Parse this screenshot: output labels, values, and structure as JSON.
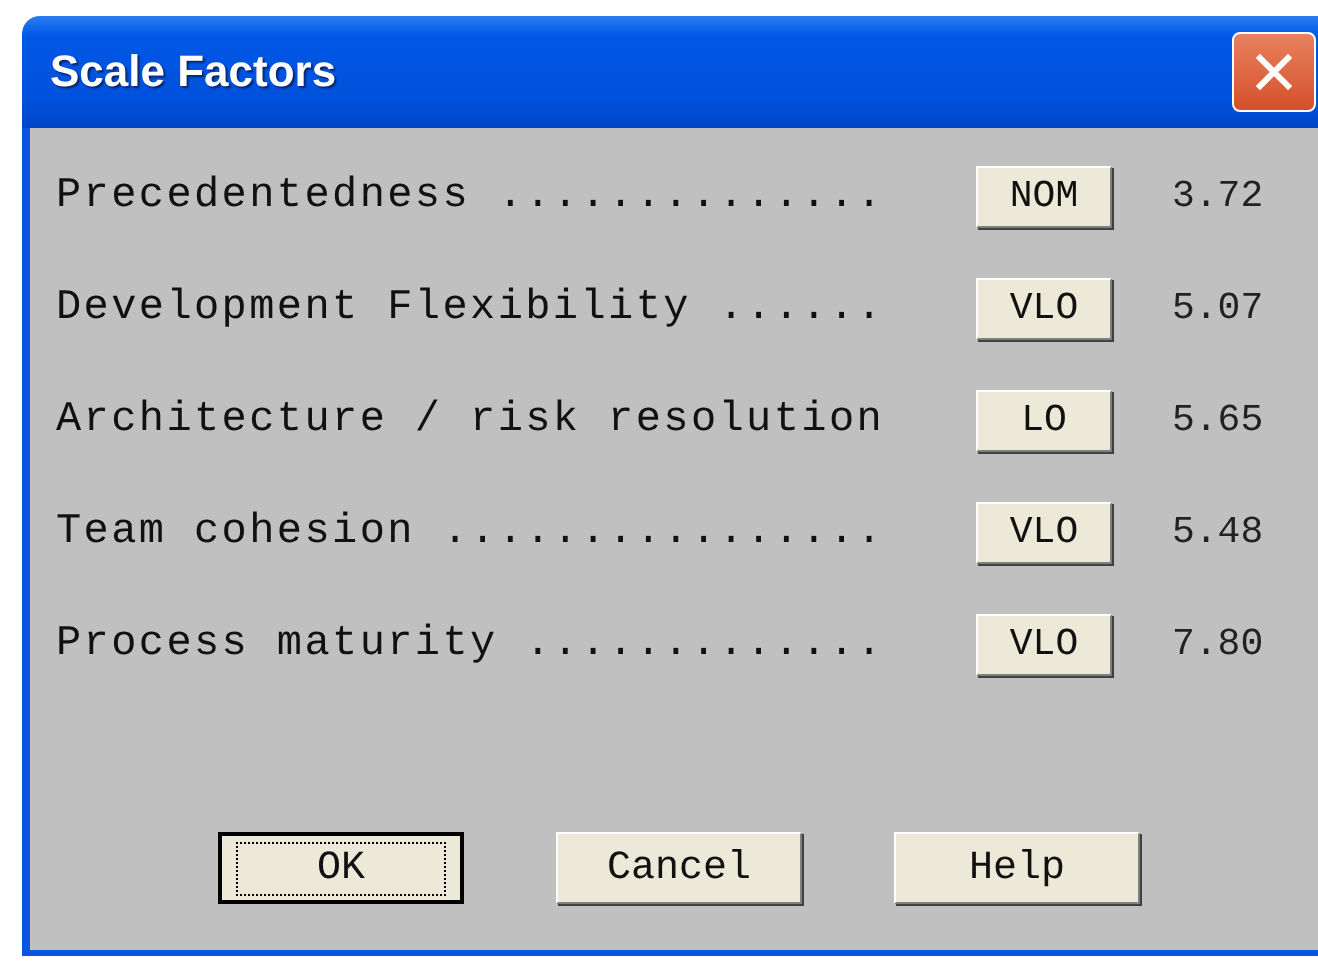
{
  "window": {
    "title": "Scale Factors"
  },
  "factors": [
    {
      "label": "Precedentedness ..............",
      "rating": "NOM",
      "value": "3.72"
    },
    {
      "label": "Development Flexibility ......",
      "rating": "VLO",
      "value": "5.07"
    },
    {
      "label": "Architecture / risk resolution",
      "rating": "LO",
      "value": "5.65"
    },
    {
      "label": "Team cohesion ................",
      "rating": "VLO",
      "value": "5.48"
    },
    {
      "label": "Process maturity .............",
      "rating": "VLO",
      "value": "7.80"
    }
  ],
  "buttons": [
    {
      "label": "OK",
      "default": true
    },
    {
      "label": "Cancel",
      "default": false
    },
    {
      "label": "Help",
      "default": false
    }
  ]
}
